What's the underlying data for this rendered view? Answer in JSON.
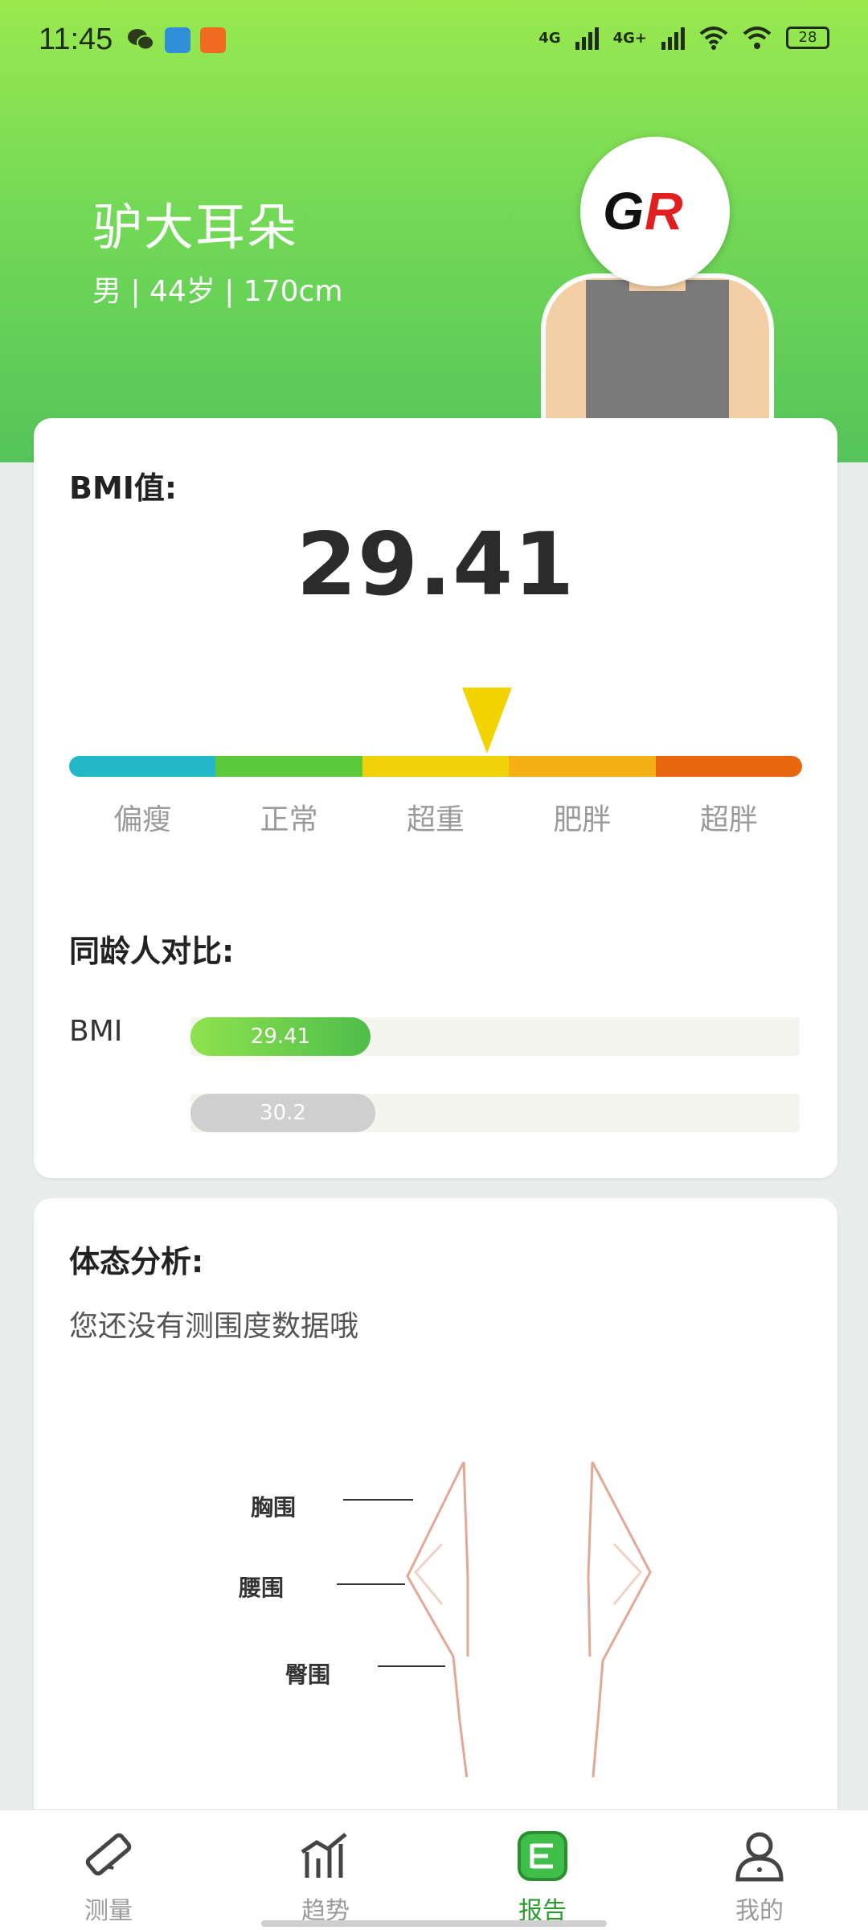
{
  "status_bar": {
    "time": "11:45",
    "network_1": "4G",
    "network_2": "4G+",
    "battery": "28"
  },
  "profile": {
    "name": "驴大耳朵",
    "info": "男 | 44岁 | 170cm",
    "logo_text": "GR"
  },
  "bmi_card": {
    "title": "BMI值:",
    "value": "29.41",
    "scale_colors": [
      "#22b8c8",
      "#5cc93a",
      "#f0d20a",
      "#f5b015",
      "#e8670f"
    ],
    "scale_labels": [
      "偏瘦",
      "正常",
      "超重",
      "肥胖",
      "超胖"
    ],
    "compare_title": "同龄人对比:",
    "compare_label": "BMI",
    "mine_value": "29.41",
    "peer_value": "30.2"
  },
  "posture_card": {
    "title": "体态分析:",
    "subtitle": "您还没有测围度数据哦",
    "labels": {
      "chest": "胸围",
      "waist": "腰围",
      "hip": "臀围"
    }
  },
  "bottom_nav": [
    {
      "label": "测量",
      "icon": "ruler-icon",
      "active": false
    },
    {
      "label": "趋势",
      "icon": "trend-chart-icon",
      "active": false
    },
    {
      "label": "报告",
      "icon": "report-icon",
      "active": true
    },
    {
      "label": "我的",
      "icon": "profile-icon",
      "active": false
    }
  ]
}
